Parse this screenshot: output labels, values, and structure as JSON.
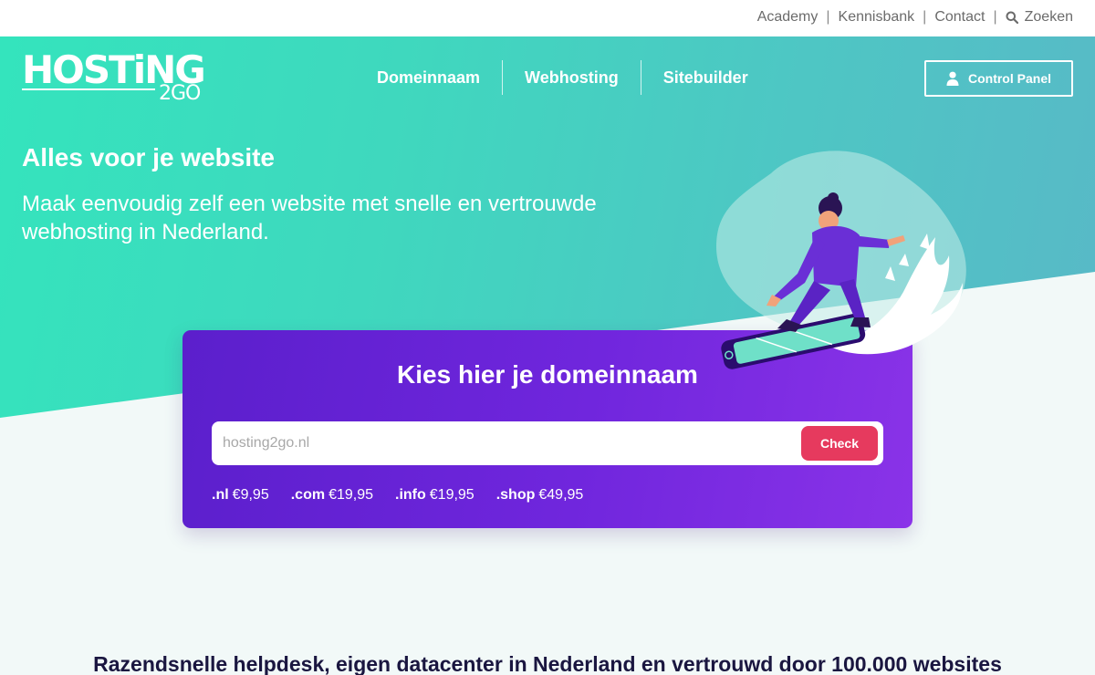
{
  "utility_nav": {
    "links": [
      "Academy",
      "Kennisbank",
      "Contact"
    ],
    "search_label": "Zoeken"
  },
  "logo": {
    "main": "HOSTiNG",
    "sub": "2GO"
  },
  "main_nav": {
    "items": [
      "Domeinnaam",
      "Webhosting",
      "Sitebuilder"
    ]
  },
  "control_panel": {
    "label": "Control Panel",
    "icon": "user-icon"
  },
  "hero": {
    "title": "Alles voor je website",
    "subtitle": "Maak eenvoudig zelf een website met snelle en vertrouwde webhosting in Nederland."
  },
  "domain_search": {
    "title": "Kies hier je domeinnaam",
    "placeholder": "hosting2go.nl",
    "check_label": "Check",
    "tlds": [
      {
        "ext": ".nl",
        "price": "€9,95"
      },
      {
        "ext": ".com",
        "price": "€19,95"
      },
      {
        "ext": ".info",
        "price": "€19,95"
      },
      {
        "ext": ".shop",
        "price": "€49,95"
      }
    ]
  },
  "bottom": {
    "title": "Razendsnelle helpdesk, eigen datacenter in Nederland en vertrouwd door 100.000 websites"
  },
  "colors": {
    "hero_start": "#34e4bd",
    "hero_end": "#58b9c7",
    "card_start": "#5b1fcc",
    "card_end": "#8a33e8",
    "check_button": "#e63a5e",
    "bottom_title": "#1a1640"
  }
}
